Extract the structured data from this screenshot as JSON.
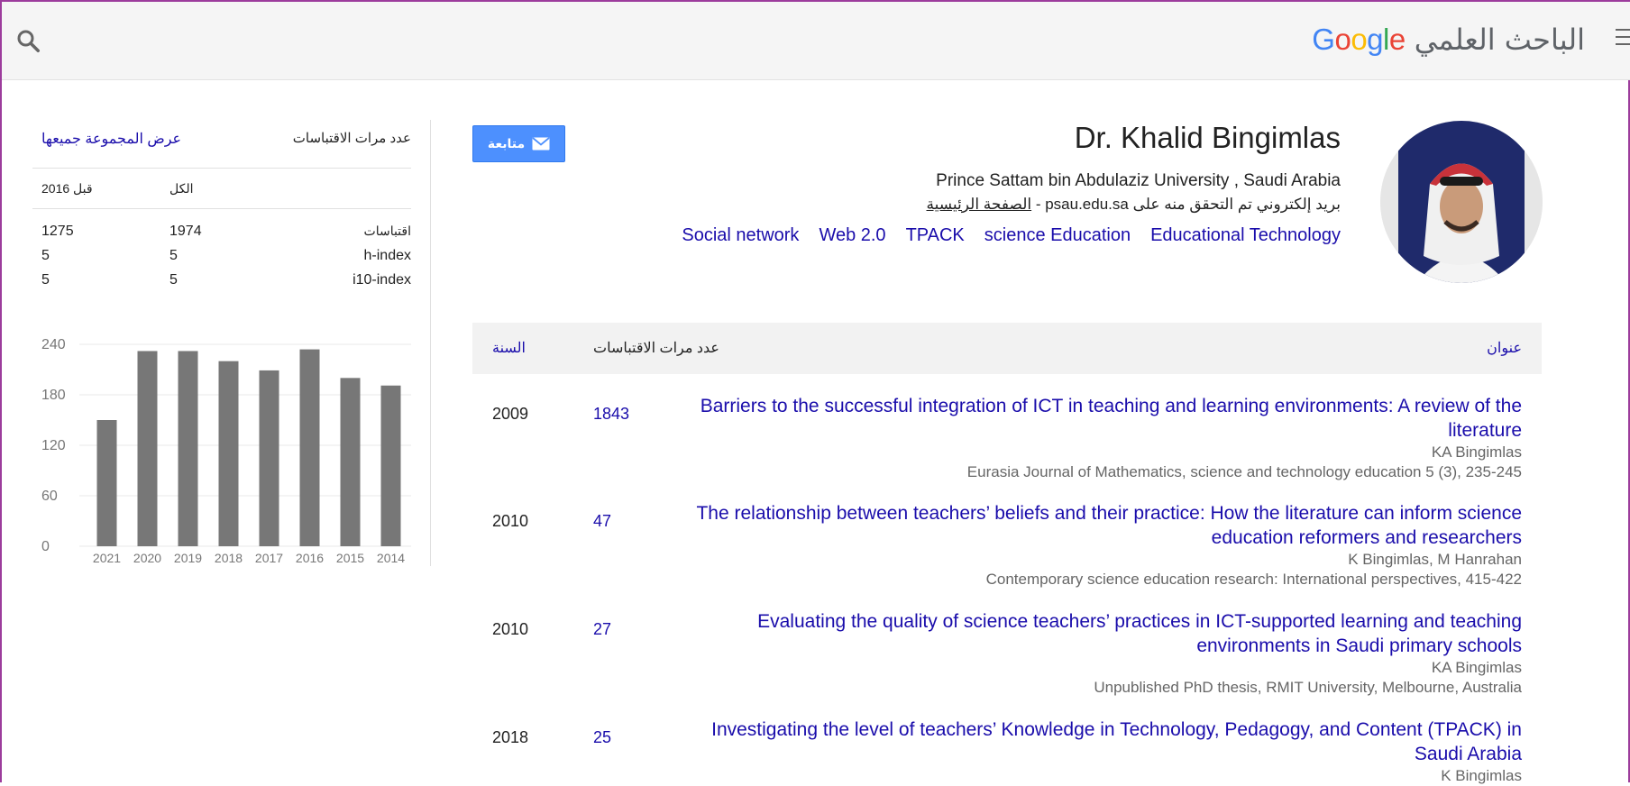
{
  "header": {
    "logo_google": "Google",
    "logo_arabic": "الباحث العلمي",
    "logo_colors": [
      "#4285f4",
      "#ea4335",
      "#fbbc05",
      "#4285f4",
      "#34a853",
      "#ea4335"
    ]
  },
  "profile": {
    "name": "Dr. Khalid Bingimlas",
    "affiliation": "Prince Sattam bin Abdulaziz University , Saudi Arabia",
    "verified_text": "بريد إلكتروني تم التحقق منه على psau.edu.sa",
    "separator": " - ",
    "homepage_label": "الصفحة الرئيسية",
    "interests": [
      "Social network",
      "Web 2.0",
      "TPACK",
      "science Education",
      "Educational Technology"
    ],
    "follow_label": "متابعة"
  },
  "citations": {
    "title": "عدد مرات الاقتباسات",
    "view_all_label": "عرض المجموعة جميعها",
    "col_since": "قبل 2016",
    "col_all": "الكل",
    "rows": [
      {
        "label": "اقتباسات",
        "all": "1974",
        "since": "1275"
      },
      {
        "label": "h-index",
        "all": "5",
        "since": "5"
      },
      {
        "label": "i10-index",
        "all": "5",
        "since": "5"
      }
    ]
  },
  "chart_data": {
    "type": "bar",
    "categories": [
      "2021",
      "2020",
      "2019",
      "2018",
      "2017",
      "2016",
      "2015",
      "2014"
    ],
    "values": [
      150,
      232,
      232,
      220,
      209,
      234,
      200,
      191
    ],
    "yticks": [
      0,
      60,
      120,
      180,
      240
    ],
    "ylim": [
      0,
      240
    ],
    "grid": true,
    "bar_color": "#777777"
  },
  "table": {
    "col_year": "السنة",
    "col_cited": "عدد مرات الاقتباسات",
    "col_title": "عنوان",
    "publications": [
      {
        "year": "2009",
        "cited": "1843",
        "title": "Barriers to the successful integration of ICT in teaching and learning environments: A review of the literature",
        "authors": "KA Bingimlas",
        "venue": "Eurasia Journal of Mathematics, science and technology education 5 (3), 235-245"
      },
      {
        "year": "2010",
        "cited": "47",
        "title": "The relationship between teachers’ beliefs and their practice: How the literature can inform science education reformers and researchers",
        "authors": "K Bingimlas, M Hanrahan",
        "venue": "Contemporary science education research: International perspectives, 415-422"
      },
      {
        "year": "2010",
        "cited": "27",
        "title": "Evaluating the quality of science teachers’ practices in ICT-supported learning and teaching environments in Saudi primary schools",
        "authors": "KA Bingimlas",
        "venue": "Unpublished PhD thesis, RMIT University, Melbourne, Australia"
      },
      {
        "year": "2018",
        "cited": "25",
        "title": "Investigating the level of teachers’ Knowledge in Technology, Pedagogy, and Content (TPACK) in Saudi Arabia",
        "authors": "K Bingimlas",
        "venue": ""
      }
    ]
  }
}
